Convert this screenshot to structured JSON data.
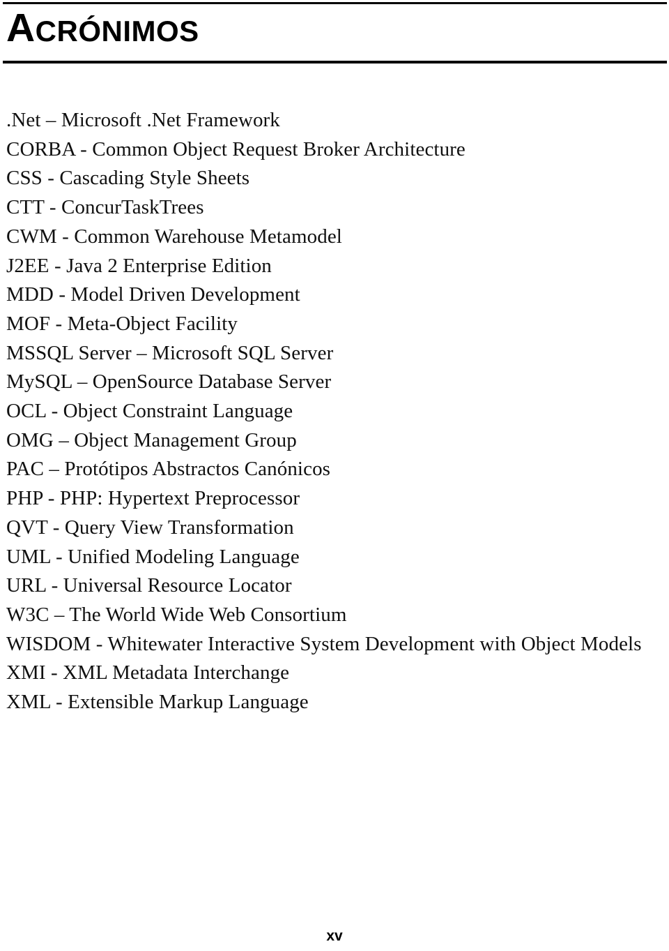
{
  "page": {
    "title": {
      "first_letter": "A",
      "rest": "CRÓNIMOS",
      "full": "ACRÓNIMOS"
    },
    "rules": {
      "top_visible": true,
      "bottom_visible": true,
      "color": "#000000"
    },
    "footer": {
      "page_number": "xv"
    },
    "text_color": "#101010",
    "background_color": "#ffffff"
  },
  "acronyms": [
    {
      "text": ".Net – Microsoft .Net Framework"
    },
    {
      "text": "CORBA - Common Object Request Broker Architecture"
    },
    {
      "text": "CSS - Cascading Style Sheets"
    },
    {
      "text": "CTT - ConcurTaskTrees"
    },
    {
      "text": "CWM - Common Warehouse Metamodel"
    },
    {
      "text": "J2EE - Java 2 Enterprise Edition"
    },
    {
      "text": "MDD - Model Driven Development"
    },
    {
      "text": "MOF - Meta-Object Facility"
    },
    {
      "text": "MSSQL Server – Microsoft SQL Server"
    },
    {
      "text": "MySQL – OpenSource Database Server"
    },
    {
      "text": "OCL - Object Constraint Language"
    },
    {
      "text": "OMG – Object Management Group"
    },
    {
      "text": "PAC – Protótipos Abstractos Canónicos"
    },
    {
      "text": "PHP - PHP: Hypertext Preprocessor"
    },
    {
      "text": "QVT - Query View Transformation"
    },
    {
      "text": "UML - Unified Modeling Language"
    },
    {
      "text": "URL - Universal Resource Locator"
    },
    {
      "text": "W3C – The World Wide Web Consortium"
    },
    {
      "text": "WISDOM - Whitewater Interactive System Development with Object Models"
    },
    {
      "text": "XMI - XML Metadata Interchange"
    },
    {
      "text": "XML - Extensible Markup Language"
    }
  ]
}
